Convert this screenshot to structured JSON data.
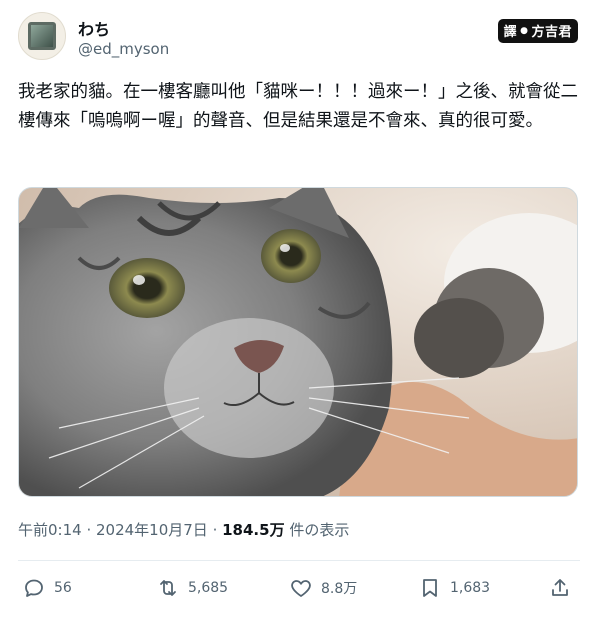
{
  "author": {
    "display_name": "わち",
    "handle": "@ed_myson",
    "avatar_icon": "framed-picture-avatar"
  },
  "badge": {
    "left": "譯",
    "separator": "●",
    "right": "方吉君"
  },
  "tweet": {
    "text": "我老家的貓。在一樓客廳叫他「貓咪ー！！！過來ー！」之後、就會從二樓傳來「嗚嗚啊ー喔」的聲音、但是結果還是不會來、真的很可愛。"
  },
  "meta": {
    "time": "午前0:14",
    "dot1": " · ",
    "date": "2024年10月7日",
    "dot2": " · ",
    "views_count": "184.5万",
    "views_label": " 件の表示"
  },
  "actions": {
    "replies": "56",
    "reposts": "5,685",
    "likes": "8.8万",
    "bookmarks": "1,683"
  }
}
